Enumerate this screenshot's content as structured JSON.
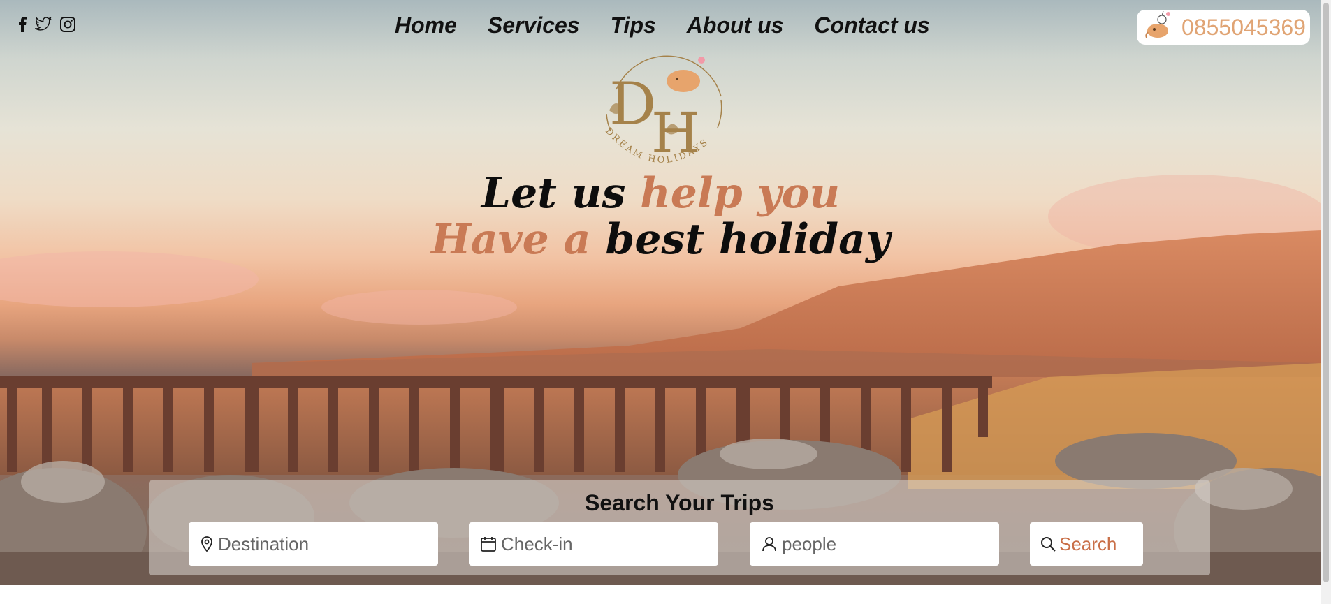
{
  "social": {
    "icons": [
      "facebook-icon",
      "twitter-icon",
      "instagram-icon"
    ]
  },
  "nav": {
    "items": [
      {
        "label": "Home"
      },
      {
        "label": "Services"
      },
      {
        "label": "Tips"
      },
      {
        "label": "About us"
      },
      {
        "label": "Contact us"
      }
    ]
  },
  "phone": {
    "number": "0855045369"
  },
  "logo": {
    "letters_left": "D",
    "letters_right": "H",
    "ring_text": "DREAM HOLIDAYS"
  },
  "headline": {
    "line1_dark": "Let us ",
    "line1_orange": "help you",
    "line2_orange": "Have a ",
    "line2_dark": "best holiday"
  },
  "search": {
    "title": "Search Your Trips",
    "destination_placeholder": "Destination",
    "checkin_placeholder": "Check-in",
    "people_placeholder": "people",
    "button_label": "Search"
  },
  "colors": {
    "accent_orange": "#c97a55",
    "phone_text": "#e0a474",
    "logo_gold": "#a5824a",
    "search_label": "#c96f48"
  }
}
